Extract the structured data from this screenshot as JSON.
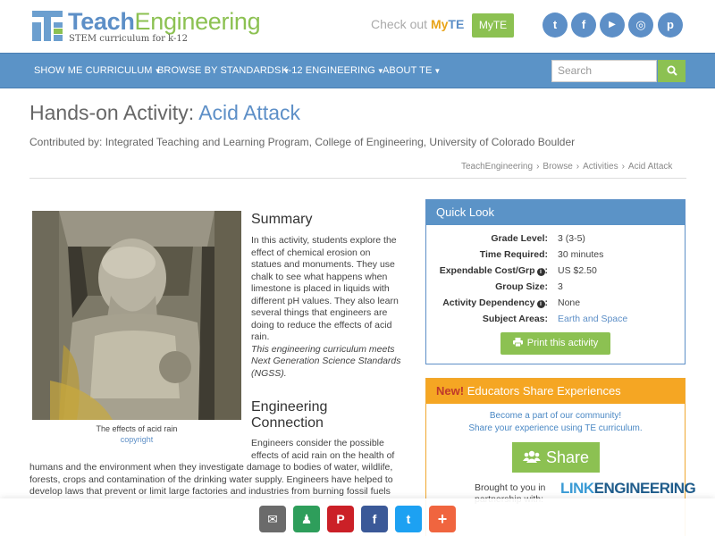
{
  "header": {
    "logo_word_1": "Teach",
    "logo_word_2": "Engineering",
    "tagline": "STEM curriculum for k-12",
    "checkout_text": "Check out",
    "checkout_my": "My",
    "checkout_te": "TE",
    "myte_button": "MyTE",
    "social": [
      {
        "icon": "twitter-icon",
        "glyph": "t"
      },
      {
        "icon": "facebook-icon",
        "glyph": "f"
      },
      {
        "icon": "youtube-icon",
        "glyph": "▶"
      },
      {
        "icon": "instagram-icon",
        "glyph": "◎"
      },
      {
        "icon": "pinterest-icon",
        "glyph": "p"
      }
    ]
  },
  "nav": {
    "items": [
      "SHOW ME CURRICULUM",
      "BROWSE BY STANDARDS",
      "K-12 ENGINEERING",
      "ABOUT TE"
    ],
    "search_placeholder": "Search"
  },
  "page": {
    "title_prefix": "Hands-on Activity:",
    "title_accent": "Acid Attack",
    "contributor": "Contributed by: Integrated Teaching and Learning Program, College of Engineering, University of Colorado Boulder",
    "breadcrumb": [
      "TeachEngineering",
      "Browse",
      "Activities",
      "Acid Attack"
    ]
  },
  "image": {
    "caption": "The effects of acid rain",
    "copyright_link": "copyright"
  },
  "summary": {
    "heading": "Summary",
    "lines": [
      "In this activity, students explore the",
      "effect of chemical erosion on",
      "statues and monuments. They use",
      "chalk to see what happens when",
      "limestone is placed in liquids with",
      "different pH values. They also learn",
      "several things that engineers are",
      "doing to reduce the effects of acid",
      "rain."
    ],
    "ngss_lines": [
      "This engineering curriculum meets",
      "Next Generation Science Standards",
      "(NGSS)."
    ]
  },
  "engineering_connection": {
    "heading_1": "Engineering",
    "heading_2": "Connection",
    "narrow_lines": [
      "Engineers consider the possible",
      "effects of acid rain on the health of"
    ],
    "wide_lines": [
      "humans and the environment when they investigate damage to bodies of water, wildlife,",
      "forests, crops and contamination of the drinking water supply. Engineers have helped to",
      "develop laws that prevent or limit large factories and industries from burning fossil fuels"
    ]
  },
  "quick_look": {
    "heading": "Quick Look",
    "rows": [
      {
        "label": "Grade Level:",
        "value": "3 (3-5)",
        "info": false,
        "link": false
      },
      {
        "label": "Time Required:",
        "value": "30 minutes",
        "info": false,
        "link": false
      },
      {
        "label": "Expendable Cost/Grp",
        "value": "US $2.50",
        "info": true,
        "link": false
      },
      {
        "label": "Group Size:",
        "value": "3",
        "info": false,
        "link": false
      },
      {
        "label": "Activity Dependency",
        "value": "None",
        "info": true,
        "link": false
      },
      {
        "label": "Subject Areas:",
        "value": "Earth and Space",
        "info": false,
        "link": true
      }
    ],
    "print_button": "Print this activity"
  },
  "educators": {
    "new_label": "New!",
    "heading": "Educators Share Experiences",
    "line_1": "Become a part of our community!",
    "line_2": "Share your experience using TE curriculum.",
    "share_button": "Share",
    "brought_1": "Brought to you in",
    "brought_2": "partnership with:",
    "partner_l": "LINK",
    "partner_rest": "ENGINEERING"
  },
  "share_bar": [
    {
      "icon": "email-icon",
      "glyph": "✉",
      "color": "#6b6b6b"
    },
    {
      "icon": "google-classroom-icon",
      "glyph": "♟",
      "color": "#2e9e5b"
    },
    {
      "icon": "pinterest-icon",
      "glyph": "P",
      "color": "#cb2027"
    },
    {
      "icon": "facebook-icon",
      "glyph": "f",
      "color": "#3b5998"
    },
    {
      "icon": "twitter-icon",
      "glyph": "t",
      "color": "#1da1f2"
    },
    {
      "icon": "plus-icon",
      "glyph": "+",
      "color": "#f0653f"
    }
  ],
  "colors": {
    "brand_blue": "#5b93c7",
    "brand_green": "#8cc152",
    "brand_orange": "#f5a623"
  }
}
